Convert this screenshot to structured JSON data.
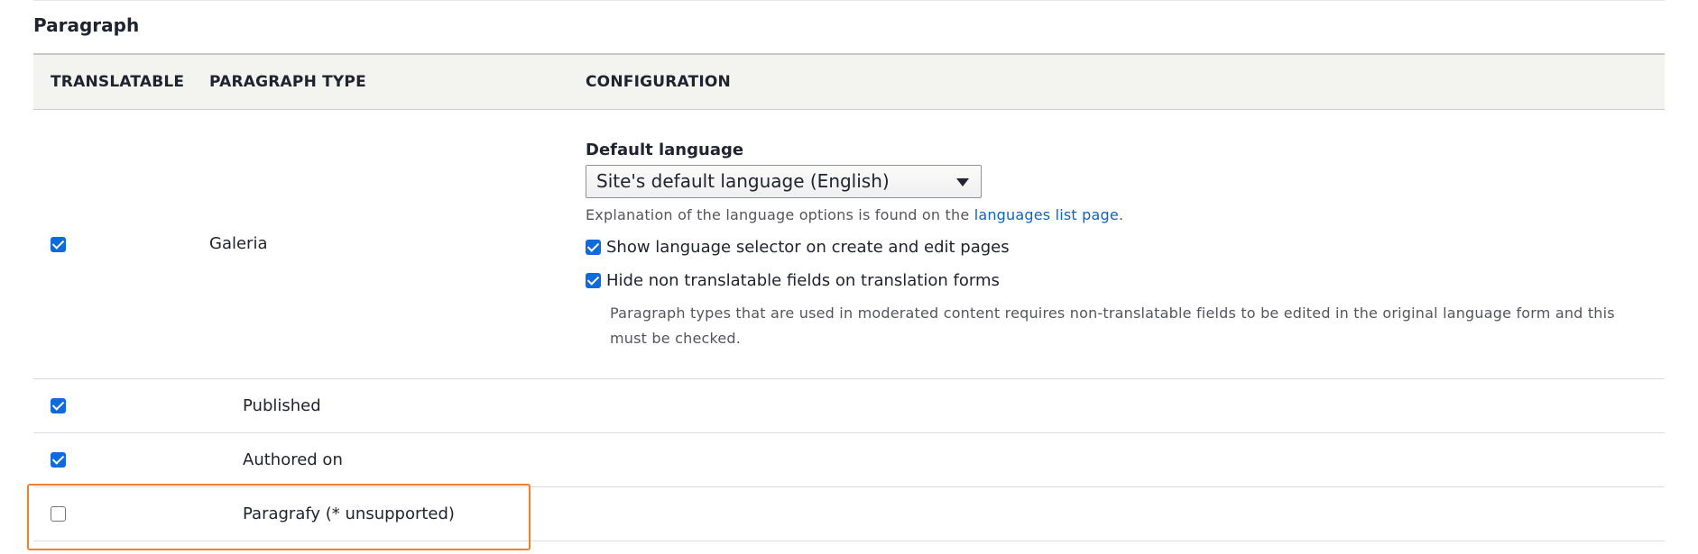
{
  "section": {
    "title": "Paragraph"
  },
  "table": {
    "headers": {
      "translatable": "TRANSLATABLE",
      "paragraph_type": "PARAGRAPH TYPE",
      "configuration": "CONFIGURATION"
    },
    "main_row": {
      "translatable_checked": true,
      "type_label": "Galeria",
      "config": {
        "default_language_label": "Default language",
        "default_language_value": "Site's default language (English)",
        "explanation_prefix": "Explanation of the language options is found on the ",
        "explanation_link": "languages list page",
        "explanation_suffix": ".",
        "show_selector_label": "Show language selector on create and edit pages",
        "show_selector_checked": true,
        "hide_non_translatable_label": "Hide non translatable fields on translation forms",
        "hide_non_translatable_checked": true,
        "hide_non_translatable_desc": "Paragraph types that are used in moderated content requires non-translatable fields to be edited in the original language form and this must be checked."
      }
    },
    "sub_rows": [
      {
        "label": "Published",
        "checked": true
      },
      {
        "label": "Authored on",
        "checked": true
      },
      {
        "label": "Paragrafy (* unsupported)",
        "checked": false
      }
    ]
  },
  "colors": {
    "accent": "#0f6bdb",
    "highlight": "#f07f2e",
    "link": "#0f63c4"
  }
}
